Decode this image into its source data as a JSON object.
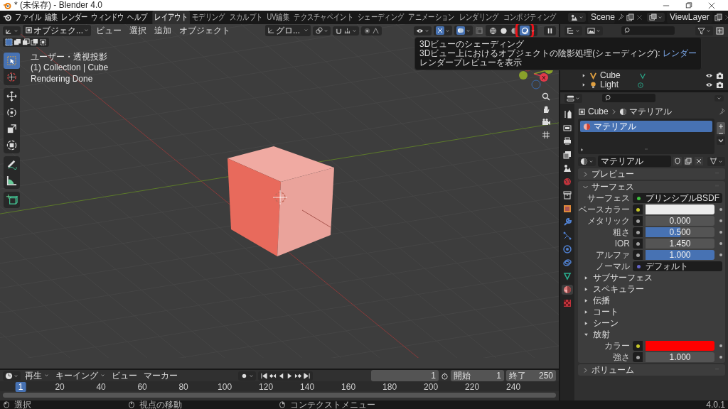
{
  "window": {
    "title": "* (未保存) - Blender 4.0"
  },
  "menu": [
    "ファイル",
    "編集",
    "レンダー",
    "ウィンドウ",
    "ヘルプ"
  ],
  "workspaces": [
    {
      "label": "レイアウト",
      "selected": true
    },
    {
      "label": "モデリング",
      "selected": false
    },
    {
      "label": "スカルプト",
      "selected": false
    },
    {
      "label": "UV編集",
      "selected": false
    },
    {
      "label": "テクスチャペイント",
      "selected": false
    },
    {
      "label": "シェーディング",
      "selected": false
    },
    {
      "label": "アニメーション",
      "selected": false
    },
    {
      "label": "レンダリング",
      "selected": false
    },
    {
      "label": "コンポジティング",
      "selected": false
    }
  ],
  "scene": "Scene",
  "view_layer": "ViewLayer",
  "viewport": {
    "mode": "オブジェク...",
    "menus": [
      "ビュー",
      "選択",
      "追加",
      "オブジェクト"
    ],
    "orientation": "グロ...",
    "shading": [
      {
        "kind": "wireframe",
        "selected": false,
        "highlighted": false
      },
      {
        "kind": "solid",
        "selected": false,
        "highlighted": false
      },
      {
        "kind": "material",
        "selected": false,
        "highlighted": false
      },
      {
        "kind": "rendered",
        "selected": true,
        "highlighted": true
      }
    ],
    "overlay_lines": [
      "ユーザー・透視投影",
      "(1) Collection | Cube",
      "Rendering Done"
    ],
    "gizmo_axis": "X",
    "tools": [
      {
        "kind": "select",
        "selected": true
      },
      {
        "kind": "cursor",
        "selected": false
      },
      {
        "kind": "move",
        "selected": false
      },
      {
        "kind": "rotate",
        "selected": false
      },
      {
        "kind": "scale",
        "selected": false
      },
      {
        "kind": "transform",
        "selected": false
      },
      {
        "kind": "annotate",
        "selected": false
      },
      {
        "kind": "measure",
        "selected": false
      },
      {
        "kind": "add",
        "selected": false
      }
    ]
  },
  "tooltip": {
    "title": "3Dビューのシェーディング",
    "description": "3Dビュー上におけるオブジェクトの陰影処理(シェーディング):",
    "value": "レンダー",
    "detail": "レンダープレビューを表示"
  },
  "outliner": {
    "items": [
      {
        "name": "Cube",
        "kind": "mesh"
      },
      {
        "name": "Light",
        "kind": "light"
      }
    ]
  },
  "properties": {
    "tabs": [
      {
        "kind": "tool",
        "selected": false
      },
      {
        "kind": "render",
        "selected": false
      },
      {
        "kind": "output",
        "selected": false
      },
      {
        "kind": "view",
        "selected": false
      },
      {
        "kind": "scene",
        "selected": false
      },
      {
        "kind": "world",
        "selected": false
      },
      {
        "kind": "collection",
        "selected": false
      },
      {
        "kind": "object",
        "selected": false
      },
      {
        "kind": "modifier",
        "selected": false
      },
      {
        "kind": "particles",
        "selected": false
      },
      {
        "kind": "physics",
        "selected": false
      },
      {
        "kind": "constraints",
        "selected": false
      },
      {
        "kind": "data",
        "selected": false
      },
      {
        "kind": "material",
        "selected": true
      },
      {
        "kind": "texture",
        "selected": false
      }
    ],
    "breadcrumb": [
      "Cube",
      "マテリアル"
    ],
    "slots": [
      {
        "name": "マテリアル",
        "selected": true
      }
    ],
    "material_name": "マテリアル",
    "panels": [
      {
        "title": "プレビュー",
        "expanded": false
      },
      {
        "title": "サーフェス",
        "expanded": true,
        "rows": [
          {
            "kind": "shader",
            "label": "サーフェス",
            "value": "プリンシプルBSDF"
          },
          {
            "kind": "color",
            "label": "ベースカラー",
            "color": "#ececec"
          },
          {
            "kind": "number",
            "label": "メタリック",
            "value": "0.000"
          },
          {
            "kind": "slider",
            "label": "粗さ",
            "value": "0.500",
            "level": 0.5
          },
          {
            "kind": "number",
            "label": "IOR",
            "value": "1.450"
          },
          {
            "kind": "slider",
            "label": "アルファ",
            "value": "1.000",
            "level": 1
          },
          {
            "kind": "vector",
            "label": "ノーマル",
            "value": "デフォルト"
          },
          {
            "kind": "sub",
            "label": "サブサーフェス",
            "expanded": false
          },
          {
            "kind": "sub",
            "label": "スペキュラー",
            "expanded": false
          },
          {
            "kind": "sub",
            "label": "伝播",
            "expanded": false
          },
          {
            "kind": "sub",
            "label": "コート",
            "expanded": false
          },
          {
            "kind": "sub",
            "label": "シーン",
            "expanded": false
          },
          {
            "kind": "sub",
            "label": "放射",
            "expanded": true
          },
          {
            "kind": "color",
            "label": "カラー",
            "color": "#ff0000"
          },
          {
            "kind": "number",
            "label": "強さ",
            "value": "1.000"
          }
        ]
      },
      {
        "title": "ボリューム",
        "expanded": false
      }
    ]
  },
  "timeline": {
    "menus": [
      "再生",
      "キーイング",
      "ビュー",
      "マーカー"
    ],
    "frame": "1",
    "start_label": "開始",
    "start": "1",
    "end_label": "終了",
    "end": "250",
    "ticks": [
      {
        "label": "1",
        "selected": true
      },
      {
        "label": "20",
        "selected": false
      },
      {
        "label": "40",
        "selected": false
      },
      {
        "label": "60",
        "selected": false
      },
      {
        "label": "80",
        "selected": false
      },
      {
        "label": "100",
        "selected": false
      },
      {
        "label": "120",
        "selected": false
      },
      {
        "label": "140",
        "selected": false
      },
      {
        "label": "160",
        "selected": false
      },
      {
        "label": "180",
        "selected": false
      },
      {
        "label": "200",
        "selected": false
      },
      {
        "label": "220",
        "selected": false
      },
      {
        "label": "240",
        "selected": false
      }
    ]
  },
  "status_bar": {
    "hints": [
      {
        "kind": "left",
        "label": "選択"
      },
      {
        "kind": "middle",
        "label": "視点の移動"
      },
      {
        "kind": "right",
        "label": "コンテクストメニュー"
      }
    ],
    "version": "4.0.1"
  }
}
